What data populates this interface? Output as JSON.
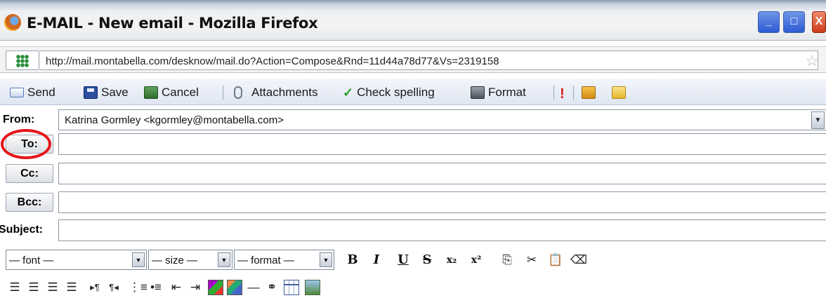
{
  "window": {
    "title": "E-MAIL - New email - Mozilla Firefox",
    "min_label": "_",
    "max_label": "□",
    "close_label": "X"
  },
  "address_bar": {
    "url": "http://mail.montabella.com/desknow/mail.do?Action=Compose&Rnd=11d44a78d77&Vs=2319158"
  },
  "toolbar": {
    "send_label": "Send",
    "save_label": "Save",
    "cancel_label": "Cancel",
    "attachments_label": "Attachments",
    "check_spelling_label": "Check spelling",
    "format_label": "Format",
    "priority_glyph": "!"
  },
  "compose": {
    "from_label": "From:",
    "from_value": "Katrina Gormley <kgormley@montabella.com>",
    "to_label": "To:",
    "cc_label": "Cc:",
    "bcc_label": "Bcc:",
    "subject_label": "Subject:"
  },
  "editor": {
    "font_select": "— font —",
    "size_select": "— size —",
    "format_select": "— format —",
    "bold_glyph": "B",
    "italic_glyph": "I",
    "underline_glyph": "U",
    "strike_glyph": "S",
    "subscript_glyph": "x₂",
    "superscript_glyph": "x²",
    "hr_glyph": "—",
    "link_glyph": "⚭"
  },
  "annotation": {
    "highlight_color": "#e5161a",
    "highlighted_field": "To:"
  },
  "colors": {
    "toolbar_bg": "#dfe6f2",
    "titlebar_btn": "#2d5bd4",
    "close_btn": "#cc3b1a"
  }
}
